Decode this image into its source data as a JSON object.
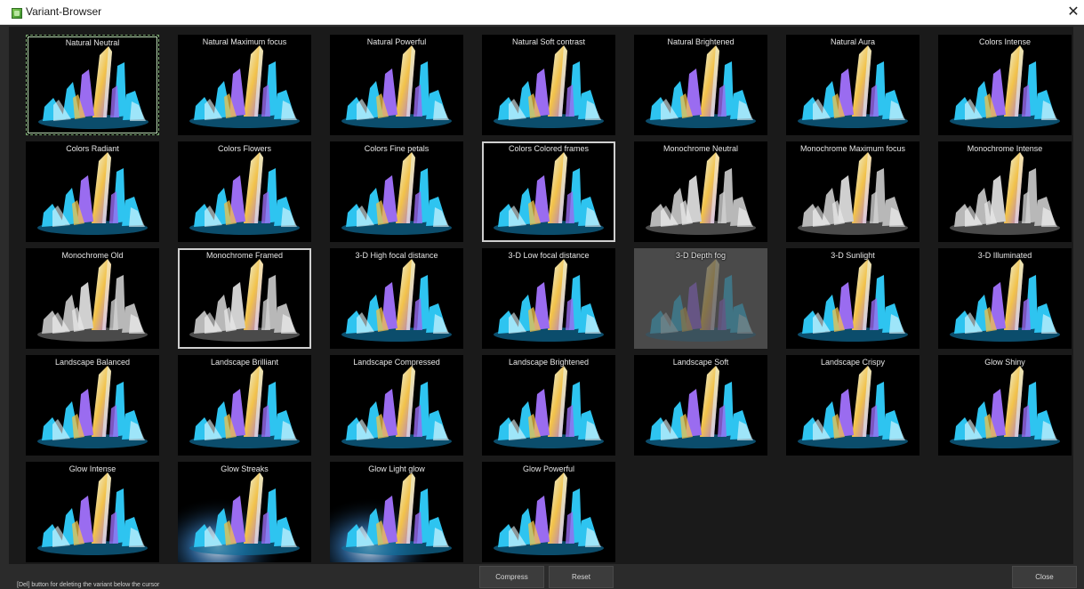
{
  "window": {
    "title": "Variant-Browser",
    "close_glyph": "✕"
  },
  "variants": [
    {
      "label": "Natural Neutral",
      "style": "color",
      "state": "active"
    },
    {
      "label": "Natural Maximum focus",
      "style": "color"
    },
    {
      "label": "Natural Powerful",
      "style": "color"
    },
    {
      "label": "Natural Soft contrast",
      "style": "color"
    },
    {
      "label": "Natural Brightened",
      "style": "color"
    },
    {
      "label": "Natural Aura",
      "style": "color"
    },
    {
      "label": "Colors Intense",
      "style": "color"
    },
    {
      "label": "Colors Radiant",
      "style": "color"
    },
    {
      "label": "Colors Flowers",
      "style": "color"
    },
    {
      "label": "Colors Fine petals",
      "style": "color"
    },
    {
      "label": "Colors Colored frames",
      "style": "colorframe",
      "state": "selected"
    },
    {
      "label": "Monochrome Neutral",
      "style": "mono"
    },
    {
      "label": "Monochrome Maximum focus",
      "style": "mono"
    },
    {
      "label": "Monochrome Intense",
      "style": "mono"
    },
    {
      "label": "Monochrome Old",
      "style": "mono"
    },
    {
      "label": "Monochrome Framed",
      "style": "mono",
      "state": "selected"
    },
    {
      "label": "3-D High focal distance",
      "style": "color"
    },
    {
      "label": "3-D Low focal distance",
      "style": "color"
    },
    {
      "label": "3-D Depth fog",
      "style": "fog"
    },
    {
      "label": "3-D Sunlight",
      "style": "color"
    },
    {
      "label": "3-D Illuminated",
      "style": "color"
    },
    {
      "label": "Landscape Balanced",
      "style": "color"
    },
    {
      "label": "Landscape Brilliant",
      "style": "color"
    },
    {
      "label": "Landscape Compressed",
      "style": "color"
    },
    {
      "label": "Landscape Brightened",
      "style": "color"
    },
    {
      "label": "Landscape Soft",
      "style": "color"
    },
    {
      "label": "Landscape Crispy",
      "style": "color"
    },
    {
      "label": "Glow Shiny",
      "style": "color"
    },
    {
      "label": "Glow Intense",
      "style": "color"
    },
    {
      "label": "Glow Streaks",
      "style": "glow"
    },
    {
      "label": "Glow Light glow",
      "style": "glow"
    },
    {
      "label": "Glow Powerful",
      "style": "color"
    }
  ],
  "status": {
    "hint": "[Del] button for deleting the variant below the cursor"
  },
  "buttons": {
    "compress": "Compress",
    "reset": "Reset",
    "close": "Close"
  },
  "colors": {
    "background": "#2b2b2b",
    "grid_background": "#1a1a1a",
    "crystal_cyan": "#2ec4f0",
    "crystal_purple": "#9a6cf0",
    "crystal_gold": "#f2c24a",
    "crystal_white": "#eafcff"
  }
}
